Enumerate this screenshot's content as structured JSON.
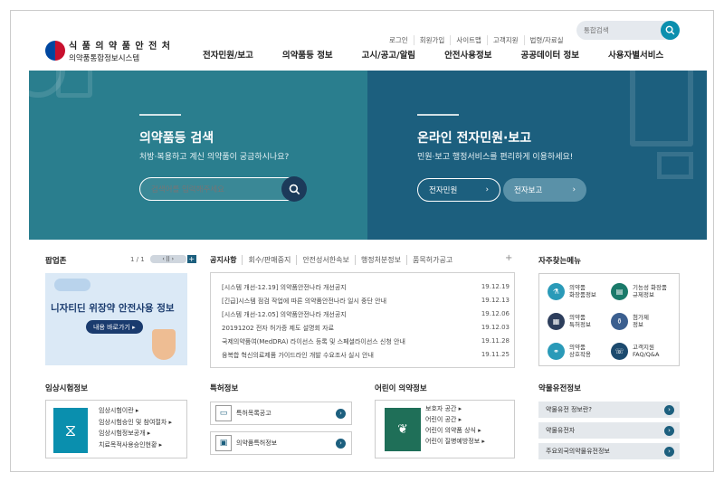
{
  "brand": {
    "title": "식 품 의 약 품 안 전 처",
    "subtitle": "의약품통합정보시스템"
  },
  "util_links": [
    "로그인",
    "회원가입",
    "사이트맵",
    "고객지원",
    "법령/자료실"
  ],
  "search": {
    "placeholder": "통합검색"
  },
  "gnb": [
    "전자민원/보고",
    "의약품등 정보",
    "고시/공고/알림",
    "안전사용정보",
    "공공데이터 정보",
    "사용자별서비스"
  ],
  "hero_left": {
    "title": "의약품등 검색",
    "subtitle": "처방·복용하고 계신 의약품이 궁금하시나요?",
    "input_placeholder": "검색어를 입력해주세요"
  },
  "hero_right": {
    "title": "온라인 전자민원·보고",
    "subtitle": "민원·보고 행정서비스를 편리하게 이용하세요!",
    "btn1": "전자민원",
    "btn2": "전자보고"
  },
  "popup": {
    "title": "팝업존",
    "page": "1 / 1",
    "banner_title": "니자티딘 위장약 안전사용 정보",
    "banner_btn": "내용 바로가기 ▸"
  },
  "tabs": [
    "공지사항",
    "회수/판매중지",
    "안전성서한속보",
    "행정처분정보",
    "품목허가공고"
  ],
  "notices": [
    {
      "text": "[시스템 개선-12.19] 의약품안전나라 개선공지",
      "date": "19.12.19"
    },
    {
      "text": "[긴급]시스템 점검 작업에 따른 의약품안전나라 일시 중단 안내",
      "date": "19.12.13"
    },
    {
      "text": "[시스템 개선-12.05] 의약품안전나라 개선공지",
      "date": "19.12.06"
    },
    {
      "text": "20191202 전자 허가증 제도 설명회 자료",
      "date": "19.12.03"
    },
    {
      "text": "국제의약품여(MedDRA) 라이선스 등록 및 스페셜라이선스 신청 안내",
      "date": "19.11.28"
    },
    {
      "text": "융복합 혁신의료제품 가이드라인 개발 수요조사 실시 안내",
      "date": "19.11.25"
    }
  ],
  "favorites": {
    "title": "자주찾는메뉴",
    "items": [
      {
        "l1": "의약품",
        "l2": "화장품정보",
        "color": "#2a9ab8"
      },
      {
        "l1": "기능성 화장품",
        "l2": "규제정보",
        "color": "#1a7a6a"
      },
      {
        "l1": "의약품",
        "l2": "특허정보",
        "color": "#2d3e5c"
      },
      {
        "l1": "첨가제",
        "l2": "정보",
        "color": "#3b5f8f"
      },
      {
        "l1": "의약품",
        "l2": "상호작용",
        "color": "#2a9ab8"
      },
      {
        "l1": "고객지원",
        "l2": "FAQ/Q&A",
        "color": "#1c4a6e"
      }
    ]
  },
  "clinical": {
    "title": "임상시험정보",
    "items": [
      "임상시험이란 ▸",
      "임상시험승인 및 참여절차 ▸",
      "임상시험정보공개 ▸",
      "치료목적사용승인현황 ▸"
    ]
  },
  "patent": {
    "title": "특허정보",
    "items": [
      "특허목록공고",
      "의약품특허정보"
    ]
  },
  "kids": {
    "title": "어린이 의약정보",
    "items": [
      "보호자 공간 ▸",
      "어린이 공간 ▸",
      "어린이 의약품 상식 ▸",
      "어린이 질병예방정보 ▸"
    ]
  },
  "pharmgen": {
    "title": "약물유전정보",
    "items": [
      "약물유전 정보란?",
      "약물유전자",
      "주요외국의약물유전정보"
    ]
  }
}
